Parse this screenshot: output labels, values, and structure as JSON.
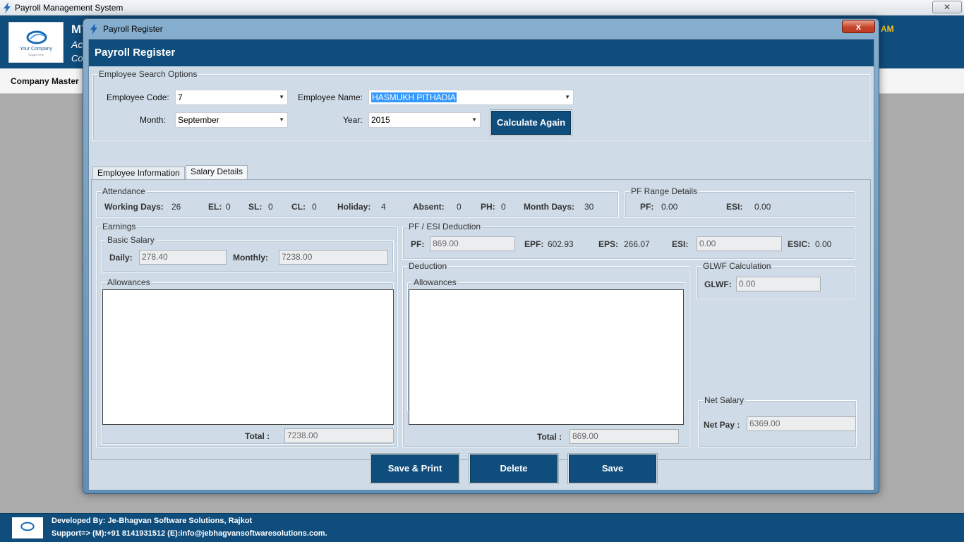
{
  "app": {
    "title": "Payroll Management System",
    "close": "✕",
    "logo_text": "Your Company",
    "logo_sub": "Slogan Here",
    "header_company": "MY",
    "header_line2": "Ac",
    "header_line3": "Co",
    "header_clock": "AM",
    "menu": {
      "company_master": "Company Master"
    },
    "footer": {
      "developed_by": "Developed By: Je-Bhagvan Software Solutions, Rajkot",
      "support": "Support=> (M):+91 8141931512 (E):info@jebhagvansoftwaresolutions.com."
    }
  },
  "dialog": {
    "window_title": "Payroll Register",
    "close": "x",
    "heading": "Payroll Register",
    "search": {
      "group_title": "Employee Search Options",
      "employee_code_label": "Employee Code:",
      "employee_code": "7",
      "employee_name_label": "Employee Name:",
      "employee_name": "HASMUKH PITHADIA",
      "month_label": "Month:",
      "month": "September",
      "year_label": "Year:",
      "year": "2015",
      "calculate_label": "Calculate Again"
    },
    "tabs": [
      {
        "label": "Employee Information"
      },
      {
        "label": "Salary Details"
      }
    ],
    "attendance": {
      "title": "Attendance",
      "working_days_label": "Working Days:",
      "working_days": "26",
      "el_label": "EL:",
      "el": "0",
      "sl_label": "SL:",
      "sl": "0",
      "cl_label": "CL:",
      "cl": "0",
      "holiday_label": "Holiday:",
      "holiday": "4",
      "absent_label": "Absent:",
      "absent": "0",
      "ph_label": "PH:",
      "ph": "0",
      "month_days_label": "Month Days:",
      "month_days": "30"
    },
    "pf_range": {
      "title": "PF Range Details",
      "pf_label": "PF:",
      "pf": "0.00",
      "esi_label": "ESI:",
      "esi": "0.00"
    },
    "earnings": {
      "title": "Earnings",
      "basic_title": "Basic Salary",
      "daily_label": "Daily:",
      "daily": "278.40",
      "monthly_label": "Monthly:",
      "monthly": "7238.00",
      "allowances_title": "Allowances",
      "total_label": "Total :",
      "total": "7238.00"
    },
    "pf_esi": {
      "title": "PF / ESI Deduction",
      "pf_label": "PF:",
      "pf": "869.00",
      "epf_label": "EPF:",
      "epf": "602.93",
      "eps_label": "EPS:",
      "eps": "266.07",
      "esi_label": "ESI:",
      "esi": "0.00",
      "esic_label": "ESIC:",
      "esic": "0.00"
    },
    "deduction": {
      "title": "Deduction",
      "allowances_title": "Allowances",
      "total_label": "Total :",
      "total": "869.00"
    },
    "glwf": {
      "title": "GLWF Calculation",
      "label": "GLWF:",
      "value": "0.00"
    },
    "net_salary": {
      "title": "Net Salary",
      "label": "Net Pay :",
      "value": "6369.00"
    },
    "buttons": {
      "save_print": "Save & Print",
      "delete": "Delete",
      "save": "Save"
    }
  },
  "colors": {
    "header_blue": "#0f4d7d",
    "panel_bg": "#cfdbe6",
    "selection": "#3399ff",
    "clock": "#f0c419"
  }
}
